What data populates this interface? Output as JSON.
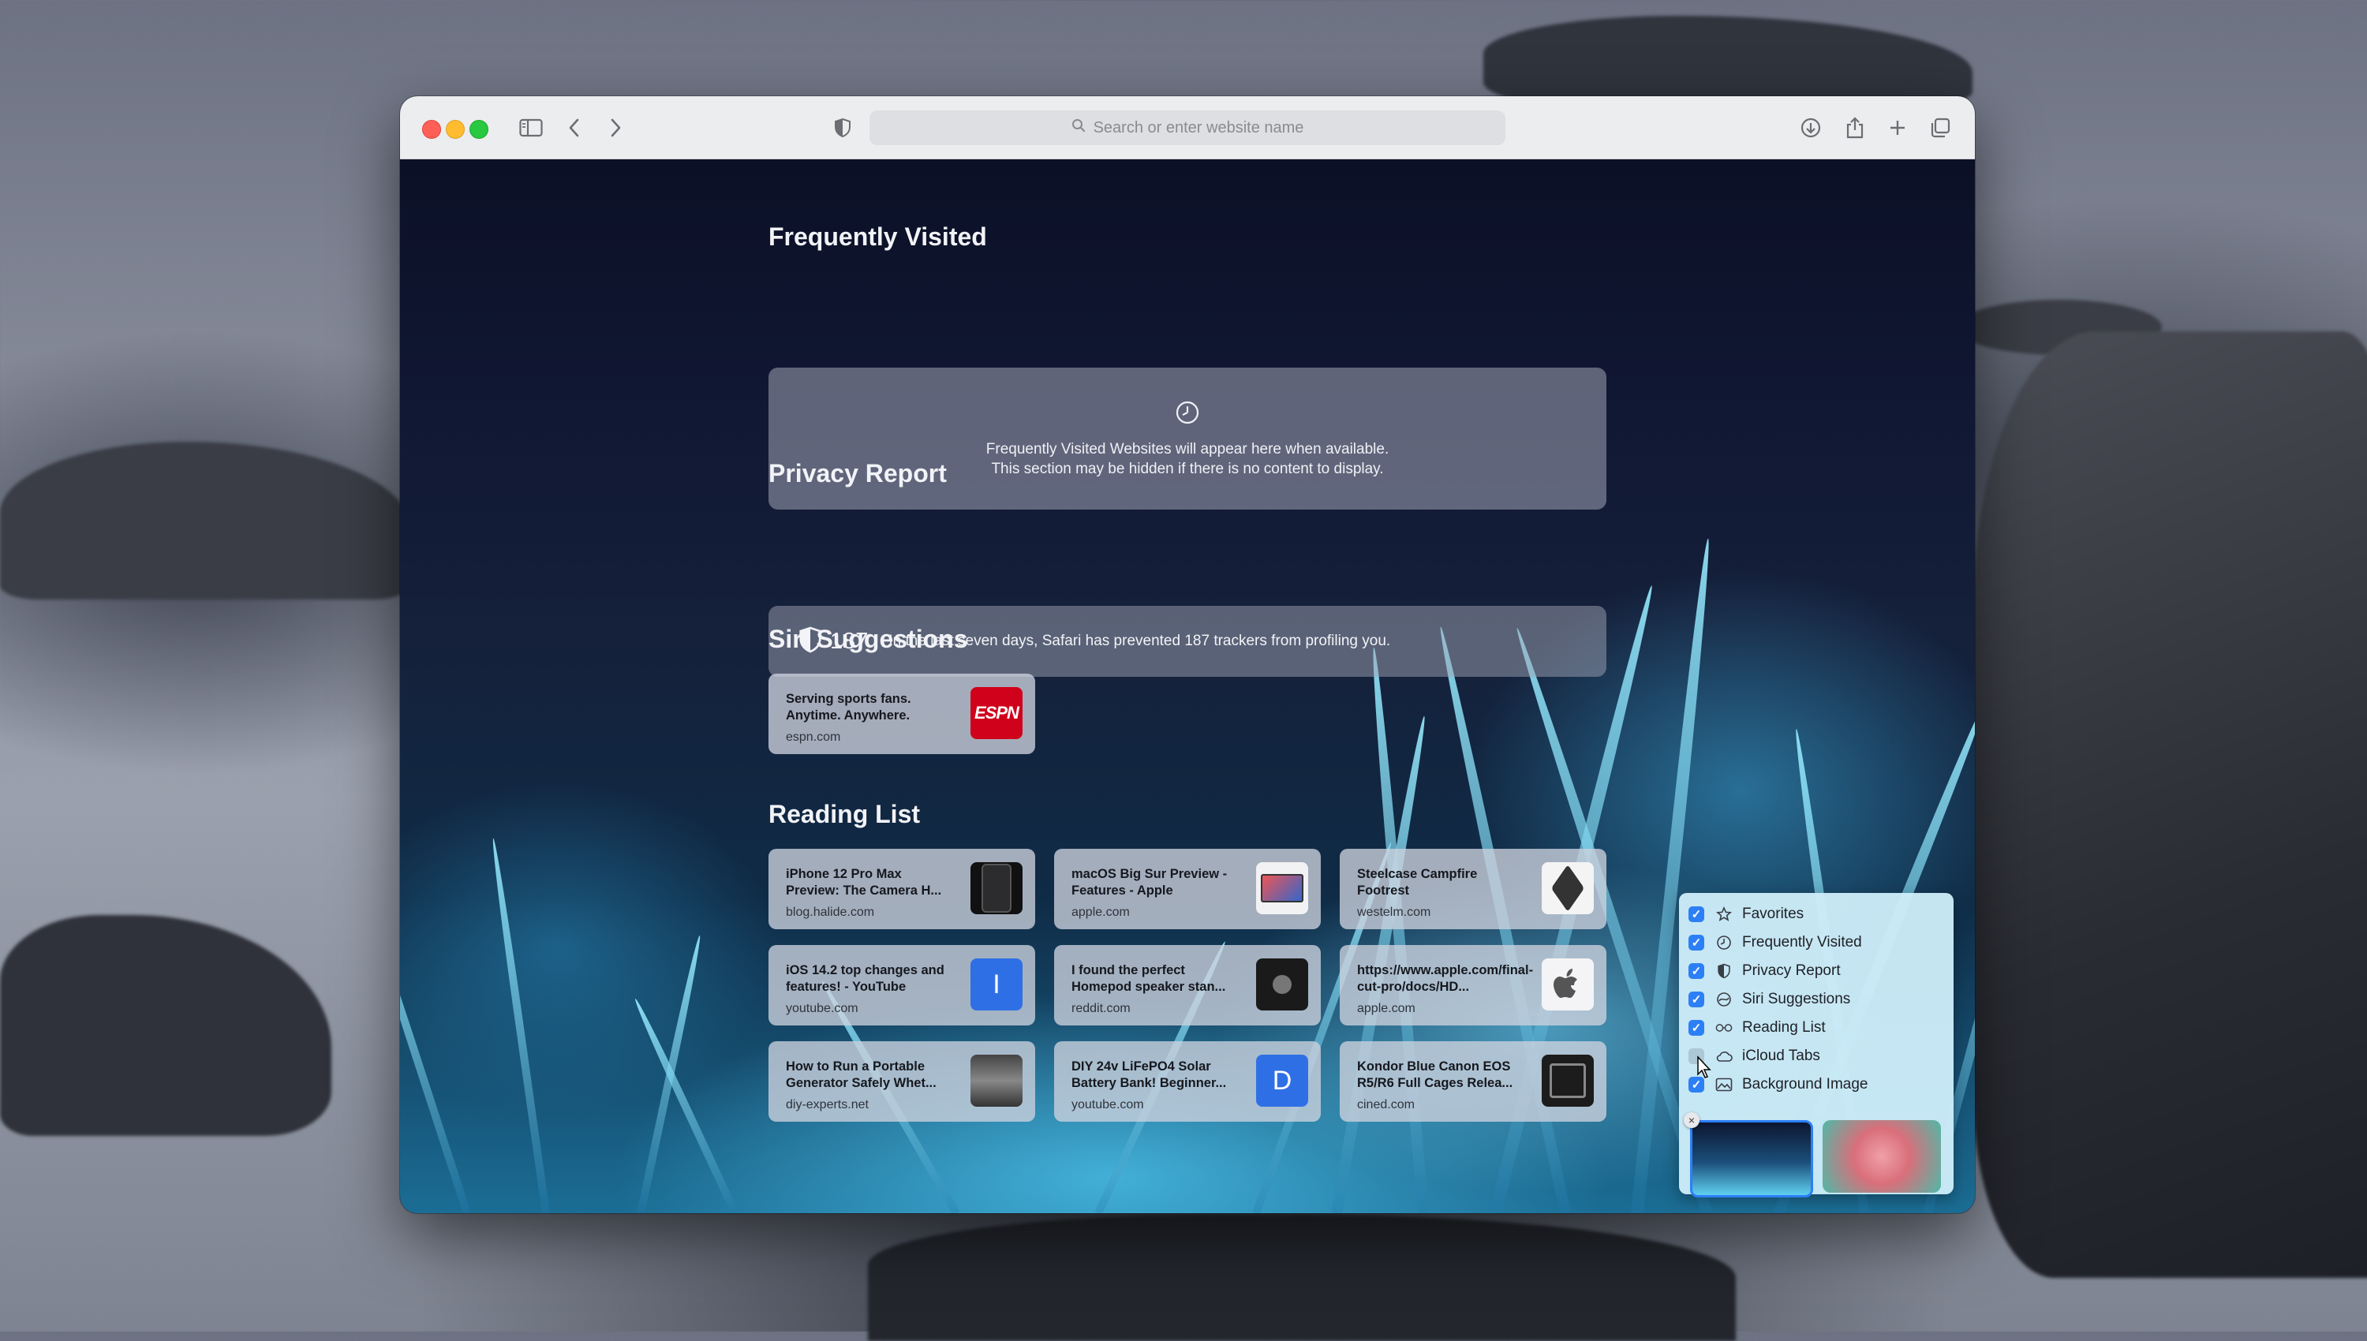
{
  "browser": {
    "address_placeholder": "Search or enter website name"
  },
  "frequently_visited": {
    "title": "Frequently Visited",
    "line1": "Frequently Visited Websites will appear here when available.",
    "line2": "This section may be hidden if there is no content to display."
  },
  "privacy_report": {
    "title": "Privacy Report",
    "count": "187",
    "text": "In the last seven days, Safari has prevented 187 trackers from profiling you."
  },
  "siri_suggestions": {
    "title": "Siri Suggestions",
    "items": [
      {
        "title": "Serving sports fans. Anytime. Anywhere.",
        "url": "espn.com",
        "thumb_text": "ESPN"
      }
    ]
  },
  "reading_list": {
    "title": "Reading List",
    "items": [
      {
        "title": "iPhone 12 Pro Max Preview: The Camera H...",
        "url": "blog.halide.com"
      },
      {
        "title": "macOS Big Sur Preview - Features - Apple",
        "url": "apple.com"
      },
      {
        "title": "Steelcase Campfire Footrest",
        "url": "westelm.com"
      },
      {
        "title": "iOS 14.2 top changes and features! - YouTube",
        "url": "youtube.com",
        "thumb_text": "I"
      },
      {
        "title": "I found the perfect Homepod speaker stan...",
        "url": "reddit.com"
      },
      {
        "title": "https://www.apple.com/final-cut-pro/docs/HD...",
        "url": "apple.com"
      },
      {
        "title": "How to Run a Portable Generator Safely Whet...",
        "url": "diy-experts.net"
      },
      {
        "title": "DIY 24v LiFePO4 Solar Battery Bank! Beginner...",
        "url": "youtube.com",
        "thumb_text": "D"
      },
      {
        "title": "Kondor Blue Canon EOS R5/R6 Full Cages Relea...",
        "url": "cined.com"
      }
    ]
  },
  "customize_panel": {
    "options": [
      {
        "label": "Favorites",
        "checked": true,
        "icon": "star-icon"
      },
      {
        "label": "Frequently Visited",
        "checked": true,
        "icon": "clock-icon"
      },
      {
        "label": "Privacy Report",
        "checked": true,
        "icon": "shield-icon"
      },
      {
        "label": "Siri Suggestions",
        "checked": true,
        "icon": "siri-icon"
      },
      {
        "label": "Reading List",
        "checked": true,
        "icon": "glasses-icon"
      },
      {
        "label": "iCloud Tabs",
        "checked": false,
        "icon": "cloud-icon"
      },
      {
        "label": "Background Image",
        "checked": true,
        "icon": "image-icon"
      }
    ]
  },
  "colors": {
    "accent": "#2d7ff5",
    "espn_red": "#d0021b"
  }
}
